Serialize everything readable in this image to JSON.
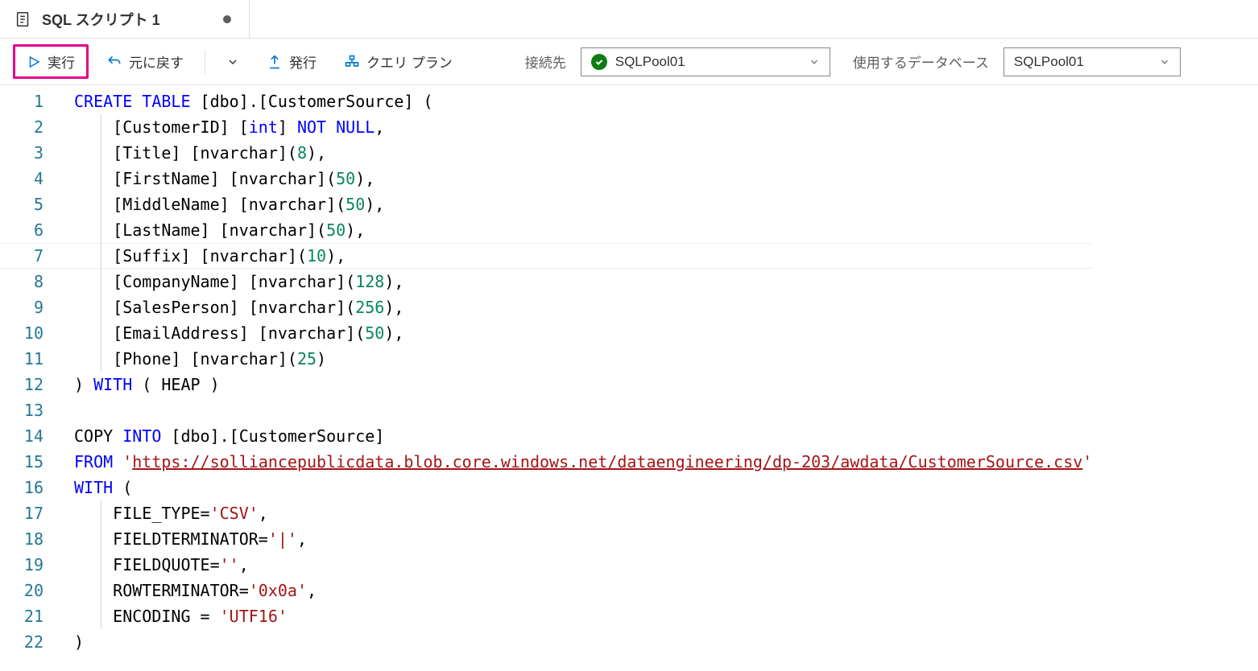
{
  "tab": {
    "title": "SQL スクリプト 1",
    "dirty": true
  },
  "toolbar": {
    "run": "実行",
    "undo": "元に戻す",
    "publish": "発行",
    "query_plan": "クエリ プラン",
    "connect_label": "接続先",
    "connect_value": "SQLPool01",
    "database_label": "使用するデータベース",
    "database_value": "SQLPool01"
  },
  "editor": {
    "highlighted_line": 7,
    "lines": [
      {
        "n": 1,
        "segs": [
          {
            "c": "kw",
            "t": "CREATE"
          },
          {
            "t": " "
          },
          {
            "c": "kw",
            "t": "TABLE"
          },
          {
            "t": " [dbo].[CustomerSource] ("
          }
        ]
      },
      {
        "n": 2,
        "indent": 1,
        "segs": [
          {
            "t": "    [CustomerID] ["
          },
          {
            "c": "kw",
            "t": "int"
          },
          {
            "t": "] "
          },
          {
            "c": "kw",
            "t": "NOT"
          },
          {
            "t": " "
          },
          {
            "c": "kw",
            "t": "NULL"
          },
          {
            "t": ","
          }
        ]
      },
      {
        "n": 3,
        "indent": 1,
        "segs": [
          {
            "t": "    [Title] [nvarchar]("
          },
          {
            "c": "num",
            "t": "8"
          },
          {
            "t": "),"
          }
        ]
      },
      {
        "n": 4,
        "indent": 1,
        "segs": [
          {
            "t": "    [FirstName] [nvarchar]("
          },
          {
            "c": "num",
            "t": "50"
          },
          {
            "t": "),"
          }
        ]
      },
      {
        "n": 5,
        "indent": 1,
        "segs": [
          {
            "t": "    [MiddleName] [nvarchar]("
          },
          {
            "c": "num",
            "t": "50"
          },
          {
            "t": "),"
          }
        ]
      },
      {
        "n": 6,
        "indent": 1,
        "segs": [
          {
            "t": "    [LastName] [nvarchar]("
          },
          {
            "c": "num",
            "t": "50"
          },
          {
            "t": "),"
          }
        ]
      },
      {
        "n": 7,
        "indent": 1,
        "segs": [
          {
            "t": "    [Suffix] [nvarchar]("
          },
          {
            "c": "num",
            "t": "10"
          },
          {
            "t": "),"
          }
        ]
      },
      {
        "n": 8,
        "indent": 1,
        "segs": [
          {
            "t": "    [CompanyName] [nvarchar]("
          },
          {
            "c": "num",
            "t": "128"
          },
          {
            "t": "),"
          }
        ]
      },
      {
        "n": 9,
        "indent": 1,
        "segs": [
          {
            "t": "    [SalesPerson] [nvarchar]("
          },
          {
            "c": "num",
            "t": "256"
          },
          {
            "t": "),"
          }
        ]
      },
      {
        "n": 10,
        "indent": 1,
        "segs": [
          {
            "t": "    [EmailAddress] [nvarchar]("
          },
          {
            "c": "num",
            "t": "50"
          },
          {
            "t": "),"
          }
        ]
      },
      {
        "n": 11,
        "indent": 1,
        "segs": [
          {
            "t": "    [Phone] [nvarchar]("
          },
          {
            "c": "num",
            "t": "25"
          },
          {
            "t": ")"
          }
        ]
      },
      {
        "n": 12,
        "segs": [
          {
            "t": ") "
          },
          {
            "c": "kw",
            "t": "WITH"
          },
          {
            "t": " ( HEAP )"
          }
        ]
      },
      {
        "n": 13,
        "segs": [
          {
            "t": ""
          }
        ]
      },
      {
        "n": 14,
        "segs": [
          {
            "t": "COPY "
          },
          {
            "c": "kw",
            "t": "INTO"
          },
          {
            "t": " [dbo].[CustomerSource]"
          }
        ]
      },
      {
        "n": 15,
        "segs": [
          {
            "c": "kw",
            "t": "FROM"
          },
          {
            "t": " "
          },
          {
            "c": "str",
            "t": "'"
          },
          {
            "c": "url",
            "t": "https://solliancepublicdata.blob.core.windows.net/dataengineering/dp-203/awdata/CustomerSource.csv"
          },
          {
            "c": "str",
            "t": "'"
          }
        ]
      },
      {
        "n": 16,
        "segs": [
          {
            "c": "kw",
            "t": "WITH"
          },
          {
            "t": " ("
          }
        ]
      },
      {
        "n": 17,
        "indent": 1,
        "segs": [
          {
            "t": "    FILE_TYPE="
          },
          {
            "c": "str",
            "t": "'CSV'"
          },
          {
            "t": ","
          }
        ]
      },
      {
        "n": 18,
        "indent": 1,
        "segs": [
          {
            "t": "    FIELDTERMINATOR="
          },
          {
            "c": "str",
            "t": "'|'"
          },
          {
            "t": ","
          }
        ]
      },
      {
        "n": 19,
        "indent": 1,
        "segs": [
          {
            "t": "    FIELDQUOTE="
          },
          {
            "c": "str",
            "t": "''"
          },
          {
            "t": ","
          }
        ]
      },
      {
        "n": 20,
        "indent": 1,
        "segs": [
          {
            "t": "    ROWTERMINATOR="
          },
          {
            "c": "str",
            "t": "'0x0a'"
          },
          {
            "t": ","
          }
        ]
      },
      {
        "n": 21,
        "indent": 1,
        "segs": [
          {
            "t": "    ENCODING = "
          },
          {
            "c": "str",
            "t": "'UTF16'"
          }
        ]
      },
      {
        "n": 22,
        "segs": [
          {
            "t": ")"
          }
        ]
      }
    ]
  }
}
